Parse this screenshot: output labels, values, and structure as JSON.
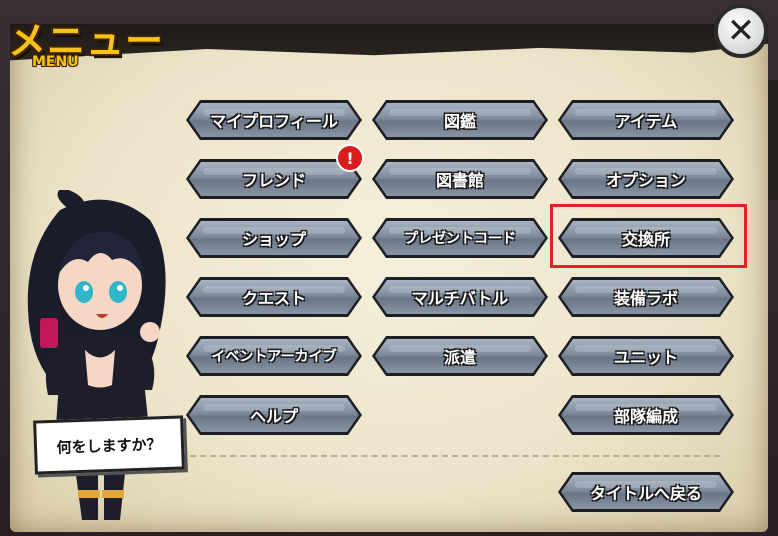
{
  "header": {
    "title_jp": "メニュー",
    "title_en": "MENU",
    "close_label": "✕"
  },
  "menu": {
    "col1": [
      "マイプロフィール",
      "フレンド",
      "ショップ",
      "クエスト",
      "イベントアーカイブ",
      "ヘルプ"
    ],
    "col2": [
      "図鑑",
      "図書館",
      "プレゼントコード",
      "マルチバトル",
      "派遣"
    ],
    "col3": [
      "アイテム",
      "オプション",
      "交換所",
      "装備ラボ",
      "ユニット",
      "部隊編成"
    ],
    "back_to_title": "タイトルへ戻る"
  },
  "notification": {
    "badge": "!"
  },
  "character": {
    "speech": "何をしますか？"
  },
  "colors": {
    "accent": "#f7c318",
    "highlight": "#e0202a",
    "panel": "#ece3c8",
    "button": "#7f8b9c"
  }
}
